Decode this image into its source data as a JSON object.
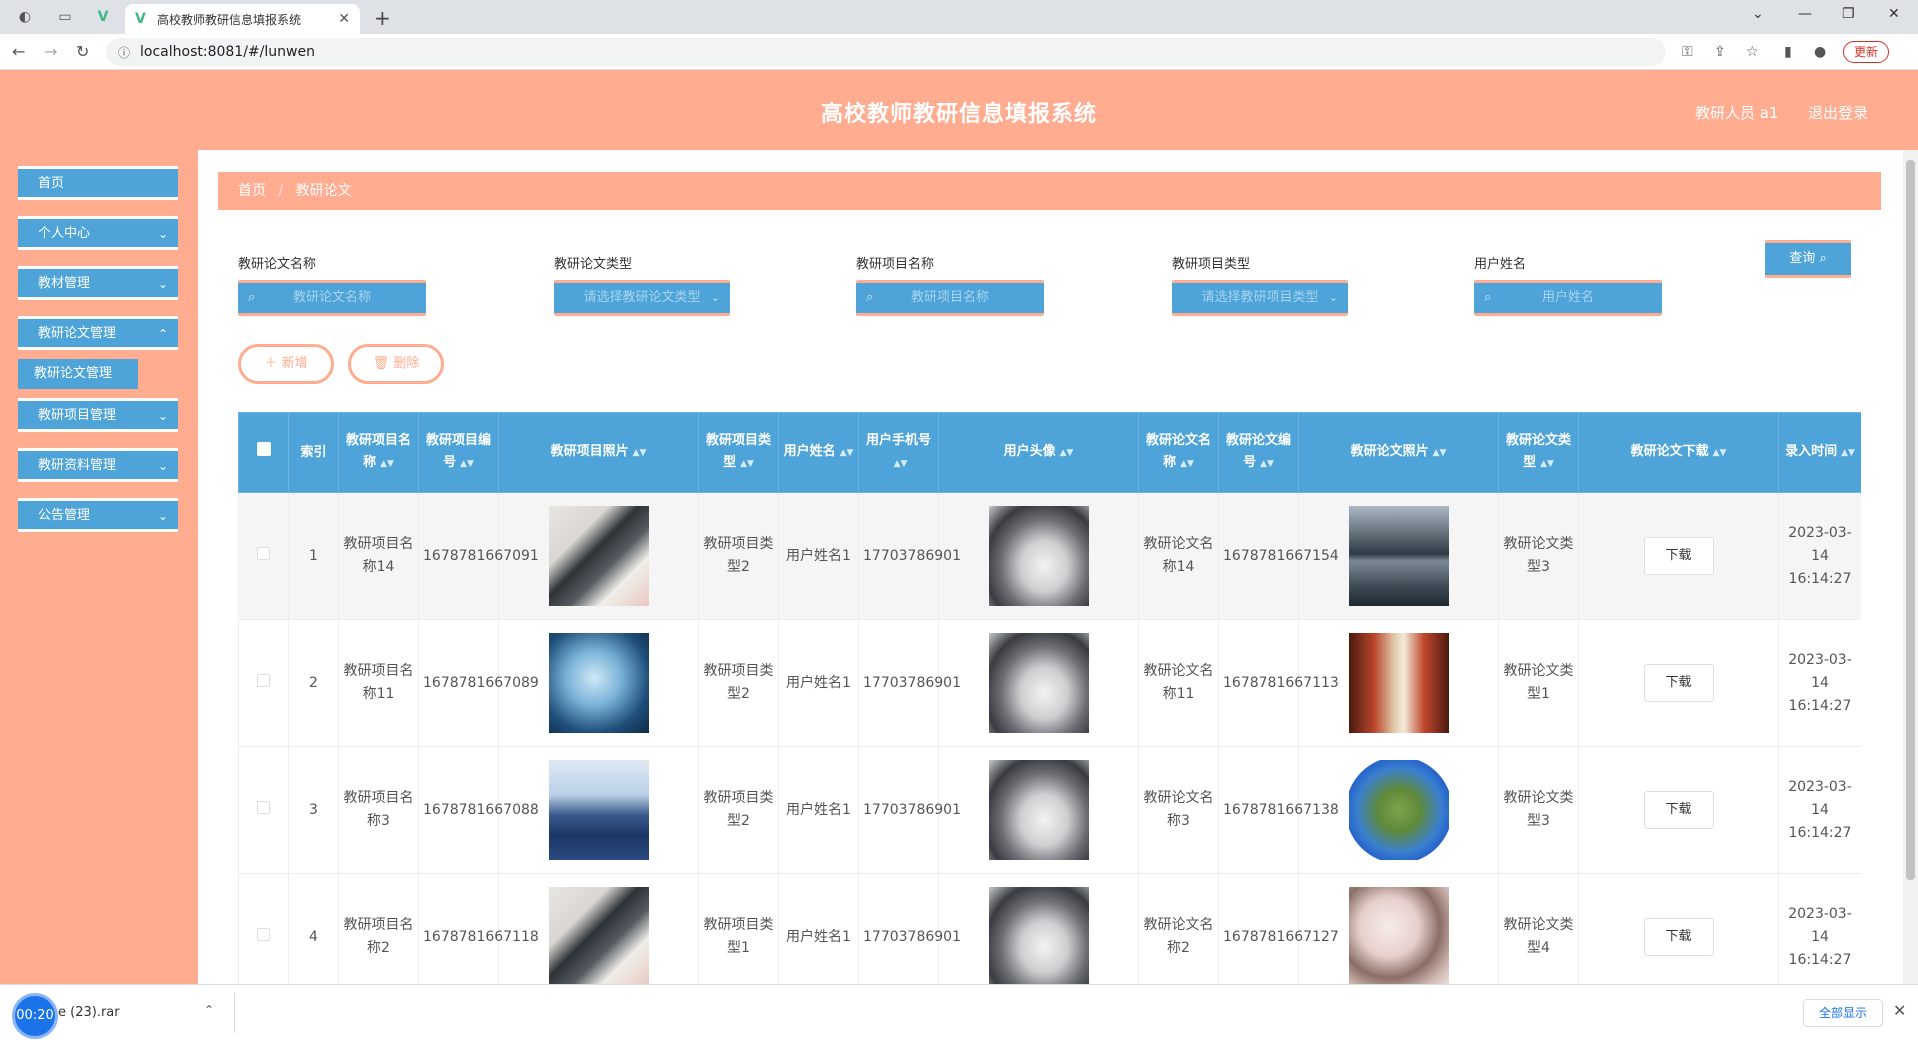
{
  "browser": {
    "tab_title": "高校教师教研信息填报系统",
    "url": "localhost:8081/#/lunwen",
    "update_label": "更新"
  },
  "header": {
    "title": "高校教师教研信息填报系统",
    "user": "教研人员 a1",
    "logout": "退出登录"
  },
  "sidebar": {
    "items": [
      {
        "label": "首页"
      },
      {
        "label": "个人中心"
      },
      {
        "label": "教材管理"
      },
      {
        "label": "教研论文管理"
      },
      {
        "label": "教研项目管理"
      },
      {
        "label": "教研资料管理"
      },
      {
        "label": "公告管理"
      }
    ],
    "active_sub": "教研论文管理"
  },
  "breadcrumb": {
    "home": "首页",
    "current": "教研论文"
  },
  "filters": {
    "f1": {
      "label": "教研论文名称",
      "placeholder": "教研论文名称"
    },
    "f2": {
      "label": "教研论文类型",
      "placeholder": "请选择教研论文类型"
    },
    "f3": {
      "label": "教研项目名称",
      "placeholder": "教研项目名称"
    },
    "f4": {
      "label": "教研项目类型",
      "placeholder": "请选择教研项目类型"
    },
    "f5": {
      "label": "用户姓名",
      "placeholder": "用户姓名"
    },
    "query": "查询"
  },
  "actions": {
    "add": "新增",
    "delete": "删除"
  },
  "table": {
    "headers": [
      "索引",
      "教研项目名称",
      "教研项目编号",
      "教研项目照片",
      "教研项目类型",
      "用户姓名",
      "用户手机号",
      "用户头像",
      "教研论文名称",
      "教研论文编号",
      "教研论文照片",
      "教研论文类型",
      "教研论文下载",
      "录入时间"
    ],
    "rows": [
      {
        "idx": "1",
        "proj_name": "教研项目名称14",
        "proj_no": "1678781667091",
        "proj_type": "教研项目类型2",
        "user": "用户姓名1",
        "phone": "17703786901",
        "paper_name": "教研论文名称14",
        "paper_no": "1678781667154",
        "paper_type": "教研论文类型3",
        "download": "下载",
        "time": "2023-03-14 16:14:27"
      },
      {
        "idx": "2",
        "proj_name": "教研项目名称11",
        "proj_no": "1678781667089",
        "proj_type": "教研项目类型2",
        "user": "用户姓名1",
        "phone": "17703786901",
        "paper_name": "教研论文名称11",
        "paper_no": "1678781667113",
        "paper_type": "教研论文类型1",
        "download": "下载",
        "time": "2023-03-14 16:14:27"
      },
      {
        "idx": "3",
        "proj_name": "教研项目名称3",
        "proj_no": "1678781667088",
        "proj_type": "教研项目类型2",
        "user": "用户姓名1",
        "phone": "17703786901",
        "paper_name": "教研论文名称3",
        "paper_no": "1678781667138",
        "paper_type": "教研论文类型3",
        "download": "下载",
        "time": "2023-03-14 16:14:27"
      },
      {
        "idx": "4",
        "proj_name": "教研项目名称2",
        "proj_no": "1678781667118",
        "proj_type": "教研项目类型1",
        "user": "用户姓名1",
        "phone": "17703786901",
        "paper_name": "教研论文名称2",
        "paper_no": "1678781667127",
        "paper_type": "教研论文类型4",
        "download": "下载",
        "time": "2023-03-14 16:14:27"
      }
    ]
  },
  "downloads": {
    "timer": "00:20",
    "file": "e (23).rar",
    "show_all": "全部显示"
  },
  "colors": {
    "accent": "#ffac90",
    "primary": "#4ea4d9"
  }
}
